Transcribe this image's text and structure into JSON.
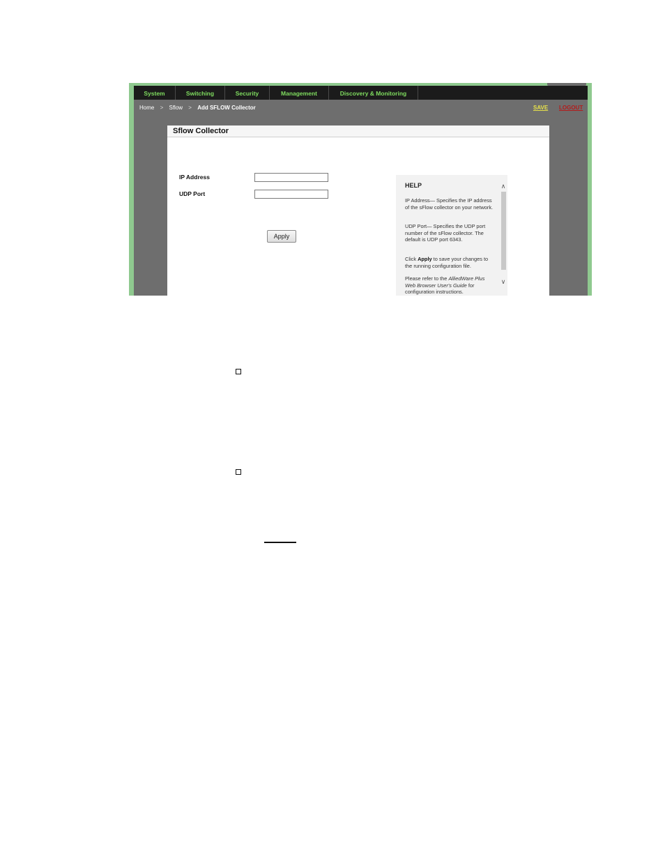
{
  "nav": {
    "items": [
      {
        "label": "System"
      },
      {
        "label": "Switching"
      },
      {
        "label": "Security"
      },
      {
        "label": "Management"
      },
      {
        "label": "Discovery & Monitoring"
      }
    ]
  },
  "breadcrumb": {
    "home": "Home",
    "sep1": ">",
    "sflow": "Sflow",
    "sep2": ">",
    "current": "Add SFLOW Collector"
  },
  "header_links": {
    "save": "SAVE",
    "logout": "LOGOUT"
  },
  "panel": {
    "title": "Sflow Collector",
    "ip_label": "IP Address",
    "ip_value": "",
    "udp_label": "UDP Port",
    "udp_value": "",
    "apply_label": "Apply"
  },
  "help": {
    "title": "HELP",
    "p1": "IP Address— Specifies the IP address of the sFlow collector on your network.",
    "p2": "UDP Port— Specifies the UDP port number of the sFlow collector. The default is UDP port 6343.",
    "p3_pre": "Click ",
    "p3_bold": "Apply",
    "p3_post": " to save your changes to the running configuration file.",
    "p4_pre": "Please refer to the ",
    "p4_italic": "AlliedWare Plus Web Browser User's Guide",
    "p4_post": " for configuration instructions."
  },
  "colors": {
    "nav_text": "#7fdc5f",
    "frame_green": "#8fc98f",
    "background_gray": "#6e6e6e",
    "save_link": "#e6e04a",
    "logout_link": "#b31b1b"
  }
}
